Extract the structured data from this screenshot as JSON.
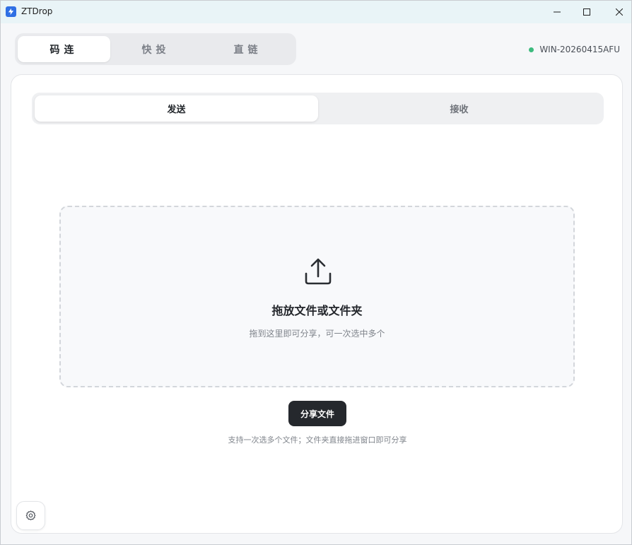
{
  "window": {
    "title": "ZTDrop",
    "controls": {
      "minimize": "minimize-icon",
      "maximize": "maximize-icon",
      "close": "close-icon"
    }
  },
  "mode_tabs": [
    {
      "label": "码连",
      "active": true
    },
    {
      "label": "快投",
      "active": false
    },
    {
      "label": "直链",
      "active": false
    }
  ],
  "device": {
    "name": "WIN-20260415AFU",
    "status": "online",
    "status_color": "#3dbb7e"
  },
  "sub_tabs": [
    {
      "label": "发送",
      "active": true
    },
    {
      "label": "接收",
      "active": false
    }
  ],
  "dropzone": {
    "icon": "upload-icon",
    "title": "拖放文件或文件夹",
    "subtitle": "拖到这里即可分享，可一次选中多个"
  },
  "share_button": {
    "label": "分享文件"
  },
  "hint": "支持一次选多个文件；文件夹直接拖进窗口即可分享",
  "settings": {
    "icon": "gear-icon"
  },
  "colors": {
    "accent_dark": "#25282d",
    "app_icon": "#2f6fe4",
    "titlebar_bg": "#e9f4f7"
  }
}
